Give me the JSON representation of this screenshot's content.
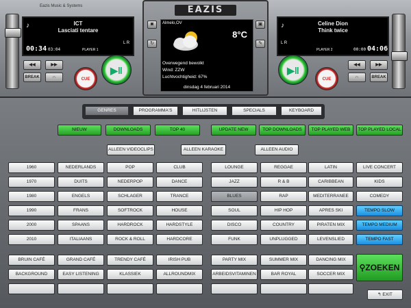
{
  "deck": {
    "company": "Eazis Music & Systems",
    "logo": "EAZIS",
    "left": {
      "artist": "ICT",
      "track": "Lasciati tentare",
      "time_elapsed": "00:34",
      "time_remaining": "03:04",
      "player": "PLAYER 1",
      "lr": "L R",
      "break_label": "BREAK",
      "cue_label": "CUE"
    },
    "right": {
      "artist": "Celine Dion",
      "track": "Think twice",
      "time_elapsed": "00:00",
      "time_remaining": "04:06",
      "player": "PLAYER 2",
      "lr": "L R",
      "break_label": "BREAK",
      "cue_label": "CUE"
    },
    "weather": {
      "place": "Almelo,OV",
      "temp": "8°C",
      "desc": "Overwegend bewolkt",
      "wind": "Wind: ZZW",
      "humidity": "Luchtvochtigheid: 67%",
      "date": "dinsdag 4 februari 2014"
    }
  },
  "tabs": [
    "GENRES",
    "PROGRAMMA'S",
    "HITLIJSTEN",
    "SPECIALS",
    "KEYBOARD"
  ],
  "quick": [
    "NIEUW",
    "DOWNLOADS",
    "TOP 40",
    "UPDATE NEW",
    "TOP DOWNLOADS",
    "TOP PLAYED WEB",
    "TOP PLAYED LOCAL"
  ],
  "filters": [
    "ALLEEN VIDEOCLIPS",
    "ALLEEN KARAOKE",
    "ALLEEN AUDIO"
  ],
  "grid": [
    [
      "1960",
      "NEDERLANDS",
      "POP",
      "CLUB",
      "LOUNGE",
      "REGGAE",
      "LATIN",
      "LIVE CONCERT"
    ],
    [
      "1970",
      "DUITS",
      "NEDERPOP",
      "DANCE",
      "JAZZ",
      "R & B",
      "CARIBBEAN",
      "KIDS"
    ],
    [
      "1980",
      "ENGELS",
      "SCHLAGER",
      "TRANCE",
      "BLUES",
      "RAP",
      "MEDITERRANEE",
      "COMEDY"
    ],
    [
      "1990",
      "FRANS",
      "SOFTROCK",
      "HOUSE",
      "SOUL",
      "HIP HOP",
      "APRES SKI",
      "TEMPO SLOW"
    ],
    [
      "2000",
      "SPAANS",
      "HARDROCK",
      "HARDSTYLE",
      "DISCO",
      "COUNTRY",
      "PIRATEN MIX",
      "TEMPO MEDIUM"
    ],
    [
      "2010",
      "ITALIAANS",
      "ROCK & ROLL",
      "HARDCORE",
      "FUNK",
      "UNPLUGGED",
      "LEVENSLIED",
      "TEMPO FAST"
    ]
  ],
  "moods": [
    [
      "BRUIN CAFÉ",
      "GRAND CAFÉ",
      "TRENDY CAFÉ",
      "IRISH PUB",
      "PARTY MIX",
      "SUMMER MIX",
      "DANCING MIX"
    ],
    [
      "BACKGROUND",
      "EASY LISTENING",
      "KLASSIEK",
      "ALLROUNDMIX",
      "ARBEIDSVITAMINEN",
      "BAR ROYAL",
      "SOCCER MIX"
    ]
  ],
  "search_label": "ZOEKEN",
  "exit_label": "EXIT",
  "colors": {
    "green": "#3cc43c",
    "blue": "#2fa8f0",
    "panel": "#6a6e72"
  },
  "icons": [
    "music-note-icon",
    "play-pause-icon",
    "prev-icon",
    "next-icon",
    "headphones-icon",
    "camera-icon",
    "film-icon",
    "refresh-icon",
    "settings-icon",
    "search-icon",
    "exit-icon",
    "cloud-sun-icon"
  ]
}
